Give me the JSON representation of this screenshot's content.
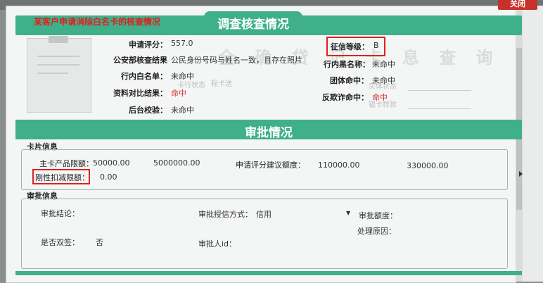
{
  "window": {
    "close_label": "关闭"
  },
  "survey": {
    "title": "调查核查情况",
    "note": "某客户申请消除白名卡的核查情况",
    "watermark": "全 确 贷 记 卡   息 查 询",
    "fields": {
      "apply_score_label": "申请评分：",
      "apply_score_value": "557.0",
      "police_check_label": "公安部核查结果",
      "police_check_value": "公民身份号码与姓名一致，且存在照片",
      "whitelist_label": "行内白名单：",
      "whitelist_value": "未命中",
      "doc_compare_label": "资料对比结果：",
      "doc_compare_value": "命中",
      "backend_check_label": "后台校验：",
      "backend_check_value": "未命中",
      "credit_grade_label": "征信等级：",
      "credit_grade_value": "B",
      "blacklist_label": "行内黑名称：",
      "blacklist_value": "未命中",
      "group_hit_label": "团体命中：",
      "group_hit_value": "未命中",
      "antifraud_label": "反欺诈命中：",
      "antifraud_value": "命中"
    },
    "faint_texts": [
      "卡行状态",
      "程卡送",
      "实体状态",
      "银卡样款"
    ]
  },
  "approval": {
    "title": "审批情况",
    "card_info": {
      "legend": "卡片信息",
      "main_limit_label": "主卡产品限额：",
      "main_limit_min": "50000.00",
      "main_limit_max": "5000000.00",
      "suggest_label": "申请评分建议额度：",
      "suggest_min": "110000.00",
      "suggest_max": "330000.00",
      "rigid_label": "刚性扣减限额：",
      "rigid_value": "0.00"
    },
    "approval_info": {
      "legend": "审批信息",
      "conclusion_label": "审批结论：",
      "grant_method_label": "审批授信方式：",
      "grant_method_value": "信用",
      "amount_label": "审批额度：",
      "reason_label": "处理原因：",
      "dual_sign_label": "是否双签：",
      "dual_sign_value": "否",
      "approver_label": "审批人id："
    }
  },
  "colors": {
    "accent": "#3fb08a",
    "highlight": "#e02020"
  }
}
